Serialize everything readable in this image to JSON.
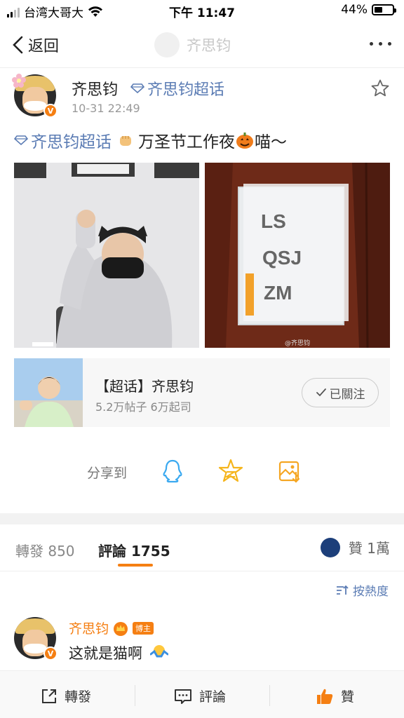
{
  "status_bar": {
    "carrier": "台湾大哥大",
    "time": "下午 11:47",
    "battery": "44%",
    "battery_level": 0.44
  },
  "nav": {
    "back_label": "返回",
    "title": "齐思钧"
  },
  "post": {
    "author": "齐思钧",
    "topic_tag": "齐思钧超话",
    "time": "10-31 22:49",
    "text_tag": "齐思钧超话",
    "text": "万圣节工作夜",
    "text_end": "喵～",
    "image2_sign": [
      "LS",
      "QSJ",
      "ZM"
    ],
    "image2_watermark": "@齐思钧"
  },
  "topic_card": {
    "title": "【超话】齐思钧",
    "subtitle": "5.2万帖子 6万起司",
    "follow_label": "已關注"
  },
  "share": {
    "label": "分享到"
  },
  "tabs": {
    "repost": "轉發 850",
    "comment": "評論 1755",
    "like": "贊 1萬"
  },
  "sort": {
    "label": "按熱度"
  },
  "comment": {
    "author": "齐思钧",
    "badge": "博主",
    "text": "这就是猫啊"
  },
  "bottom_bar": {
    "repost": "轉發",
    "comment": "評論",
    "like": "贊"
  },
  "colors": {
    "accent": "#f57f13",
    "link": "#5b7cb4"
  }
}
